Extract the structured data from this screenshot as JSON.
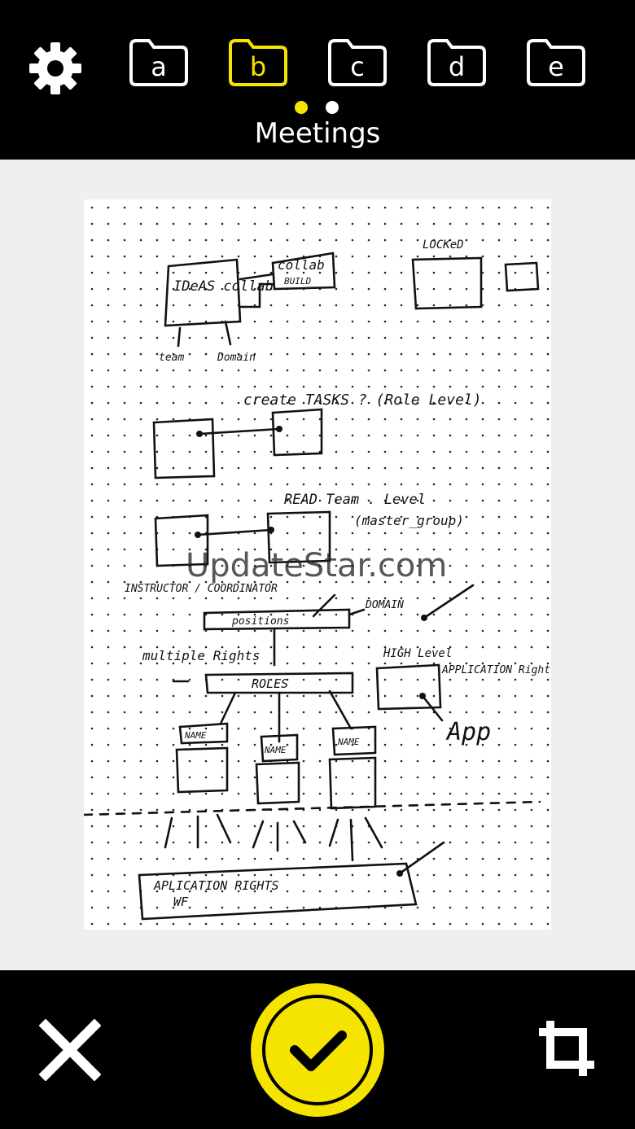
{
  "toolbar": {
    "settings_icon": "gear-icon",
    "folders": [
      {
        "letter": "a",
        "active": false
      },
      {
        "letter": "b",
        "active": true
      },
      {
        "letter": "c",
        "active": false
      },
      {
        "letter": "d",
        "active": false
      },
      {
        "letter": "e",
        "active": false
      }
    ],
    "current_folder_name": "Meetings",
    "page_dots": [
      {
        "active": true
      },
      {
        "active": false
      }
    ],
    "accent_color": "#f5e400"
  },
  "preview": {
    "watermark": "UpdateStar.com",
    "sketch_text": {
      "ideas_collab": "IDeAS collab",
      "collab_build_1": "collab",
      "collab_build_2": "BUILD",
      "locked": "LOCKeD",
      "team": "team",
      "domain_top": "Domain",
      "create_tasks": "create  TASKS ? (Role Level)",
      "read_team": "READ   Team . Level",
      "master_group": "(master_group)",
      "instructor": "INSTRUCTOR / COORDINATOR",
      "positions": "positions",
      "domain": "DOMAIN",
      "multiple_rights": "multiple Rights",
      "roles": "ROLES",
      "high_level": "HIGH Level",
      "application_rights": "APPLICATION Rights",
      "app": "App",
      "name_1": "NAME",
      "name_2": "NAME",
      "name_3": "NAME",
      "application_rights_box": "APLICATION  RIGHTS",
      "wf": "WF"
    }
  },
  "actions": {
    "cancel_icon": "close-icon",
    "confirm_icon": "checkmark-icon",
    "crop_icon": "crop-icon"
  }
}
